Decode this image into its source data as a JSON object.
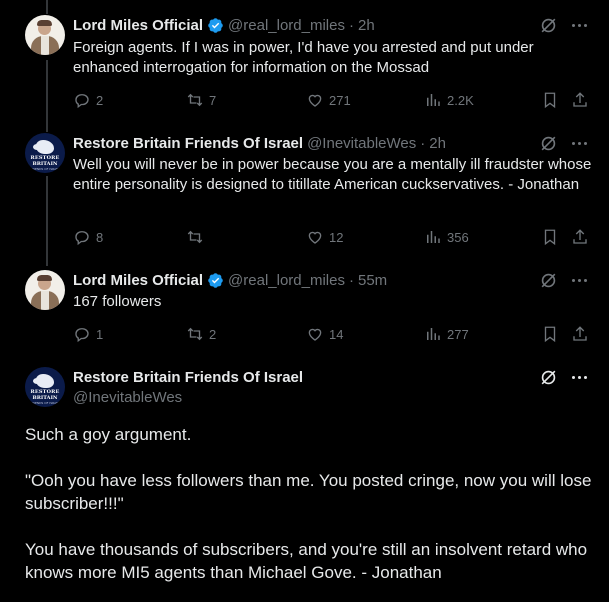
{
  "tweets": [
    {
      "name": "Lord Miles Official",
      "handle": "@real_lord_miles",
      "time": "2h",
      "text": "Foreign agents. If I was in power, I'd have you arrested and put under enhanced interrogation for information on the Mossad",
      "replies": "2",
      "retweets": "7",
      "likes": "271",
      "views": "2.2K",
      "verified": true
    },
    {
      "name": "Restore Britain Friends Of Israel",
      "handle": "@InevitableWes",
      "time": "2h",
      "text": "Well you will never be in power because you are a mentally ill fraudster whose entire personality is designed to titillate American cuckservatives. - Jonathan",
      "replies": "8",
      "retweets": "",
      "likes": "12",
      "views": "356",
      "verified": false
    },
    {
      "name": "Lord Miles Official",
      "handle": "@real_lord_miles",
      "time": "55m",
      "text": "167 followers",
      "replies": "1",
      "retweets": "2",
      "likes": "14",
      "views": "277",
      "verified": true
    }
  ],
  "main_tweet": {
    "name": "Restore Britain Friends Of Israel",
    "handle": "@InevitableWes",
    "paragraphs": [
      "Such a goy argument.",
      "\"Ooh you have less followers than me. You posted cringe, now you will lose subscriber!!!\"",
      "You have thousands of subscribers, and you're still an insolvent retard who knows more MI5 agents than Michael Gove. - Jonathan"
    ]
  },
  "avatar_rb": {
    "line1": "RESTORE",
    "line2": "BRITAIN",
    "line3": "FRIENDS OF ISRAEL"
  },
  "dot": "·",
  "colors": {
    "background": "#000000",
    "text": "#e7e9ea",
    "muted": "#71767b",
    "verified": "#1d9bf0",
    "line": "#333639"
  }
}
